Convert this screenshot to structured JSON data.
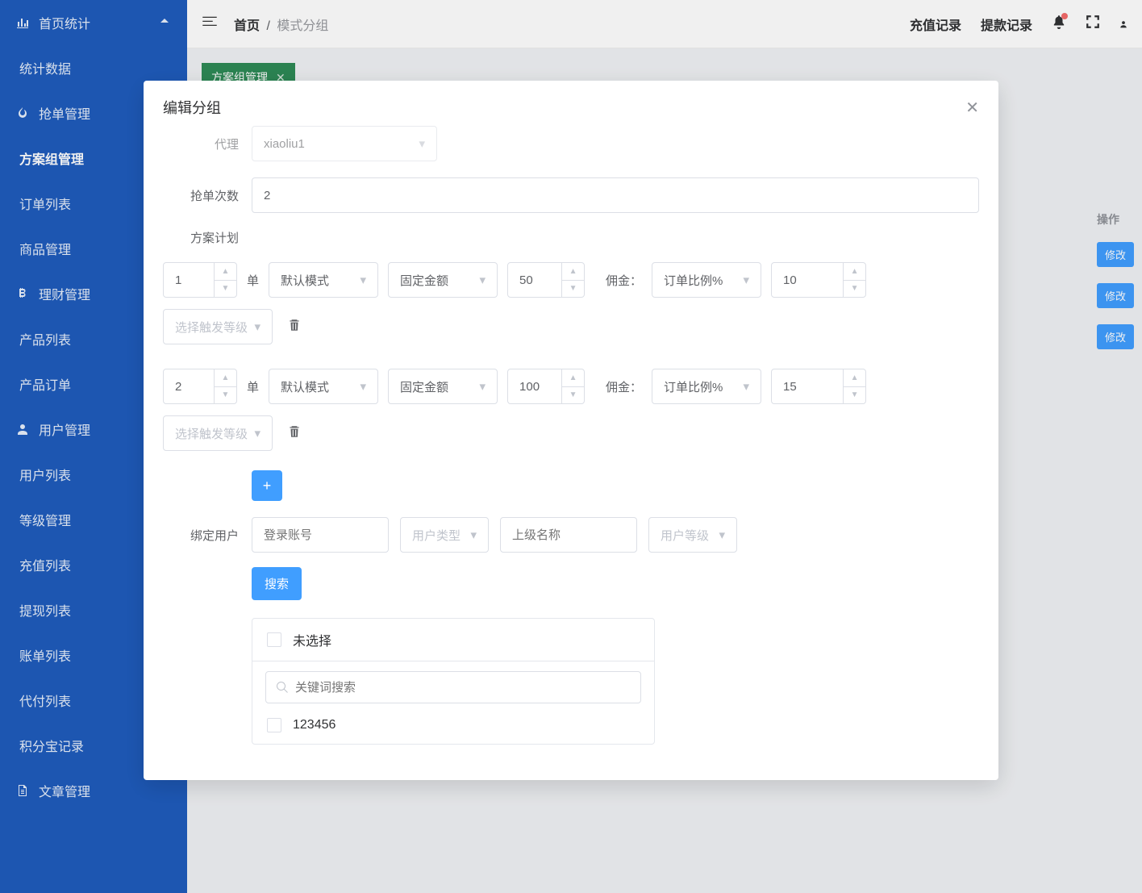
{
  "sidebar": {
    "root1": {
      "label": "首页统计",
      "icon": "chart-bar-icon"
    },
    "stats": "统计数据",
    "root2": {
      "label": "抢单管理",
      "icon": "fire-icon"
    },
    "plan_group": "方案组管理",
    "order_list": "订单列表",
    "goods": "商品管理",
    "root3": {
      "label": "理财管理",
      "icon": "bitcoin-icon"
    },
    "prod_list": "产品列表",
    "prod_order": "产品订单",
    "root4": {
      "label": "用户管理",
      "icon": "user-icon"
    },
    "user_list": "用户列表",
    "level_mgmt": "等级管理",
    "recharge_list": "充值列表",
    "withdraw_list": "提现列表",
    "bill_list": "账单列表",
    "payout_list": "代付列表",
    "jifen": "积分宝记录",
    "root5": {
      "label": "文章管理",
      "icon": "document-icon"
    }
  },
  "topbar": {
    "home": "首页",
    "current": "模式分组",
    "link_recharge": "充值记录",
    "link_withdraw": "提款记录"
  },
  "tab": {
    "label": "方案组管理"
  },
  "bgtable": {
    "action_header": "操作",
    "modify": "修改"
  },
  "dialog": {
    "title": "编辑分组",
    "agent_label": "代理",
    "agent_value": "xiaoliu1",
    "count_label": "抢单次数",
    "count_value": "2",
    "plan_label": "方案计划",
    "plans": [
      {
        "idx": "1",
        "unit": "单",
        "mode": "默认模式",
        "amt_type": "固定金额",
        "amt": "50",
        "comm_label": "佣金：",
        "comm_type": "订单比例%",
        "comm_val": "10",
        "trigger_ph": "选择触发等级"
      },
      {
        "idx": "2",
        "unit": "单",
        "mode": "默认模式",
        "amt_type": "固定金额",
        "amt": "100",
        "comm_label": "佣金：",
        "comm_type": "订单比例%",
        "comm_val": "15",
        "trigger_ph": "选择触发等级"
      }
    ],
    "add_btn": "+",
    "bind_label": "绑定用户",
    "filters": {
      "account_ph": "登录账号",
      "user_type_ph": "用户类型",
      "parent_ph": "上级名称",
      "user_level_ph": "用户等级"
    },
    "search_btn": "搜索",
    "transfer": {
      "unselected": "未选择",
      "keyword_ph": "关键词搜索",
      "item1": "123456"
    }
  }
}
